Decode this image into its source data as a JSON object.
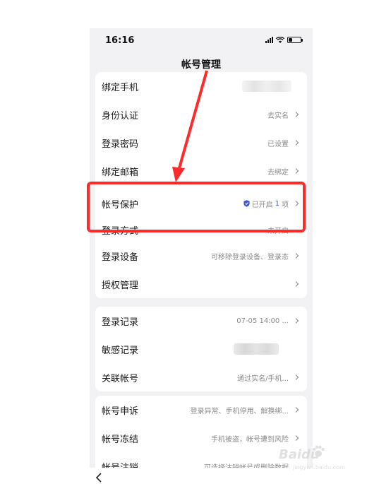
{
  "status_bar": {
    "time": "16:16"
  },
  "header": {
    "title": "帐号管理"
  },
  "sections": [
    {
      "rows": [
        {
          "label": "绑定手机",
          "value": ""
        },
        {
          "label": "身份认证",
          "value": "去实名"
        },
        {
          "label": "登录密码",
          "value": "已设置"
        },
        {
          "label": "绑定邮箱",
          "value": "去绑定"
        },
        {
          "label": "帐号保护",
          "value_prefix": "已开启",
          "value_count": "1",
          "value_suffix": "项"
        },
        {
          "label": "登录方式",
          "value": "未开启"
        },
        {
          "label": "登录设备",
          "value": "可移除登录设备、登录态"
        },
        {
          "label": "授权管理",
          "value": ""
        }
      ]
    },
    {
      "rows": [
        {
          "label": "登录记录",
          "value": "07-05 14:00 ..."
        },
        {
          "label": "敏感记录",
          "value": ""
        },
        {
          "label": "关联帐号",
          "value": "通过实名/手机..."
        }
      ]
    },
    {
      "rows": [
        {
          "label": "帐号申诉",
          "value": "登录异常、手机停用、解换绑..."
        },
        {
          "label": "帐号冻结",
          "value": "手机被盗，帐号遭到风险"
        },
        {
          "label": "帐号注销",
          "value": "可选择注销帐号或删除数据"
        }
      ]
    }
  ],
  "colors": {
    "annotation_red": "#ff2a2a",
    "accent_blue": "#3f57d6",
    "page_bg": "#f2f2f4"
  },
  "icons": [
    "signal-icon",
    "wifi-icon",
    "battery-icon",
    "chevron-right-icon",
    "shield-check-icon",
    "back-arrow-icon",
    "baidu-paw-icon"
  ],
  "watermark": {
    "brand": "Baidu",
    "sub": "jingyan.baidu.com"
  }
}
